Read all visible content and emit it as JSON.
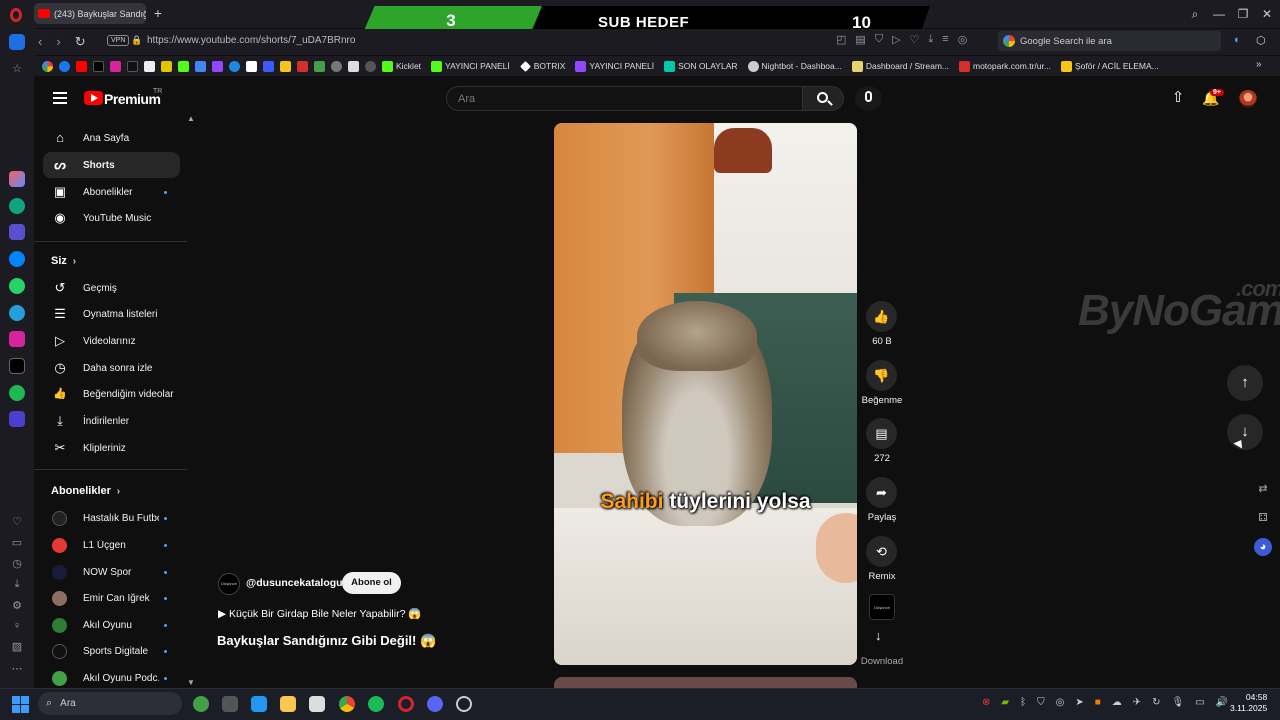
{
  "browser": {
    "tab_title": "(243) Baykuşlar Sandığ",
    "url": "https://www.youtube.com/shorts/7_uDA7BRnro",
    "vpn_label": "VPN",
    "search_placeholder": "Google Search ile ara",
    "bookmarks": [
      {
        "label": "Kicklet",
        "color": "#53fc18"
      },
      {
        "label": "YAYINCI PANELİ",
        "color": "#53fc18"
      },
      {
        "label": "BOTRIX",
        "color": "#ffffff"
      },
      {
        "label": "YAYINCI PANELİ",
        "color": "#9146ff"
      },
      {
        "label": "SON OLAYLAR",
        "color": "#00c9a7"
      },
      {
        "label": "Nightbot - Dashboa...",
        "color": "#cccccc"
      },
      {
        "label": "Dashboard / Stream...",
        "color": "#e6d36c"
      },
      {
        "label": "motopark.com.tr/ur...",
        "color": "#d32f2f"
      },
      {
        "label": "Şoför / ACİL ELEMA...",
        "color": "#f5c518"
      }
    ]
  },
  "stream_overlay": {
    "left_value": "3",
    "label": "SUB HEDEF",
    "right_value": "10"
  },
  "header": {
    "brand": "Premium",
    "brand_mark": "TR",
    "search_placeholder": "Ara",
    "notification_count": "9+"
  },
  "sidebar": {
    "main": [
      {
        "label": "Ana Sayfa",
        "icon": "home-icon",
        "glyph": "⌂"
      },
      {
        "label": "Shorts",
        "icon": "shorts-icon",
        "glyph": "ᔕ",
        "active": true
      },
      {
        "label": "Abonelikler",
        "icon": "subscriptions-icon",
        "glyph": "▣",
        "dot": true
      },
      {
        "label": "YouTube Music",
        "icon": "music-icon",
        "glyph": "◉"
      }
    ],
    "you_heading": "Siz",
    "you": [
      {
        "label": "Geçmiş",
        "icon": "history-icon",
        "glyph": "↺"
      },
      {
        "label": "Oynatma listeleri",
        "icon": "playlists-icon",
        "glyph": "☰"
      },
      {
        "label": "Videolarınız",
        "icon": "your-videos-icon",
        "glyph": "▷"
      },
      {
        "label": "Daha sonra izle",
        "icon": "watch-later-icon",
        "glyph": "◷"
      },
      {
        "label": "Beğendiğim videolar",
        "icon": "liked-icon",
        "glyph": "👍"
      },
      {
        "label": "İndirilenler",
        "icon": "downloads-icon",
        "glyph": "⤓"
      },
      {
        "label": "Klipleriniz",
        "icon": "clips-icon",
        "glyph": "✂"
      }
    ],
    "subs_heading": "Abonelikler",
    "subscriptions": [
      {
        "label": "Hastalık Bu Futbol",
        "color": "#222222"
      },
      {
        "label": "L1 Üçgen",
        "color": "#e53935"
      },
      {
        "label": "NOW Spor",
        "color": "#1a1a3a"
      },
      {
        "label": "Emir Can İğrek",
        "color": "#8d6e63"
      },
      {
        "label": "Akıl Oyunu",
        "color": "#2e7d32"
      },
      {
        "label": "Sports Digitale",
        "color": "#111111"
      },
      {
        "label": "Akıl Oyunu Podc...",
        "color": "#43a047"
      }
    ]
  },
  "short": {
    "caption_highlight": "Sahibi",
    "caption_rest": "tüylerini yolsa",
    "channel_handle": "@dusuncekatalogu",
    "channel_avatar_text": "Düşünce Kataloğu",
    "subscribe_label": "Abone ol",
    "playlist_text": "▶ Küçük Bir Girdap Bile Neler Yapabilir? 😱",
    "title": "Baykuşlar Sandığınız Gibi Değil! 😱",
    "actions": {
      "likes": "60 B",
      "dislike": "Beğenme",
      "comments": "272",
      "share": "Paylaş",
      "remix": "Remix",
      "download": "Download"
    }
  },
  "watermark": {
    "brand": "ByNoGame",
    "suffix": ".com"
  },
  "taskbar": {
    "search_label": "Ara",
    "time": "04:58",
    "date": "3.11.2025"
  }
}
